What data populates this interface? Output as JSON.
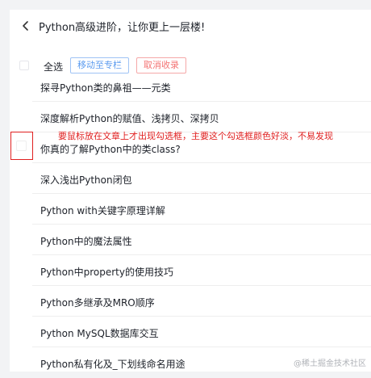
{
  "header": {
    "title": "Python高级进阶，让你更上一层楼!"
  },
  "toolbar": {
    "select_all_label": "全选",
    "move_button": "移动至专栏",
    "cancel_button": "取消收录"
  },
  "articles": [
    "探寻Python类的鼻祖——元类",
    "深度解析Python的赋值、浅拷贝、深拷贝",
    "你真的了解Python中的类class?",
    "深入浅出Python闭包",
    "Python with关键字原理详解",
    "Python中的魔法属性",
    "Python中property的使用技巧",
    "Python多继承及MRO顺序",
    "Python MySQL数据库交互",
    "Python私有化及_下划线命名用途"
  ],
  "annotation": "要鼠标放在文章上才出现勾选框，主要这个勾选框颜色好淡，不易发现",
  "watermark": "@稀土掘金技术社区",
  "colors": {
    "annotation_red": "#e02020",
    "move_button_blue": "#5b9bef",
    "cancel_button_red": "#f47474"
  },
  "icons": {
    "back": "chevron-left-icon"
  }
}
